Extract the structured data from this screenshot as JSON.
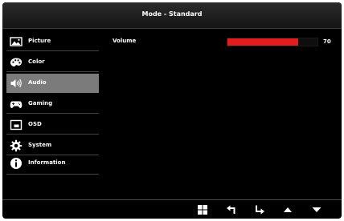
{
  "header": {
    "title": "Mode - Standard"
  },
  "sidebar": {
    "items": [
      {
        "label": "Picture",
        "icon": "picture-icon"
      },
      {
        "label": "Color",
        "icon": "palette-icon"
      },
      {
        "label": "Audio",
        "icon": "speaker-icon",
        "selected": true
      },
      {
        "label": "Gaming",
        "icon": "gamepad-icon"
      },
      {
        "label": "OSD",
        "icon": "osd-icon"
      },
      {
        "label": "System",
        "icon": "gear-icon"
      },
      {
        "label": "Information",
        "icon": "info-icon"
      }
    ]
  },
  "settings": {
    "volume": {
      "label": "Volume",
      "value": "70",
      "level": 0.79
    }
  },
  "colors": {
    "background": "#000000",
    "selected": "#7b7b7b",
    "slider_fill": "#e31d1d",
    "text": "#ffffff"
  },
  "nav_buttons": [
    {
      "icon": "menu-grid-icon"
    },
    {
      "icon": "back-icon"
    },
    {
      "icon": "enter-icon"
    },
    {
      "icon": "up-arrow-icon"
    },
    {
      "icon": "down-arrow-icon"
    }
  ]
}
